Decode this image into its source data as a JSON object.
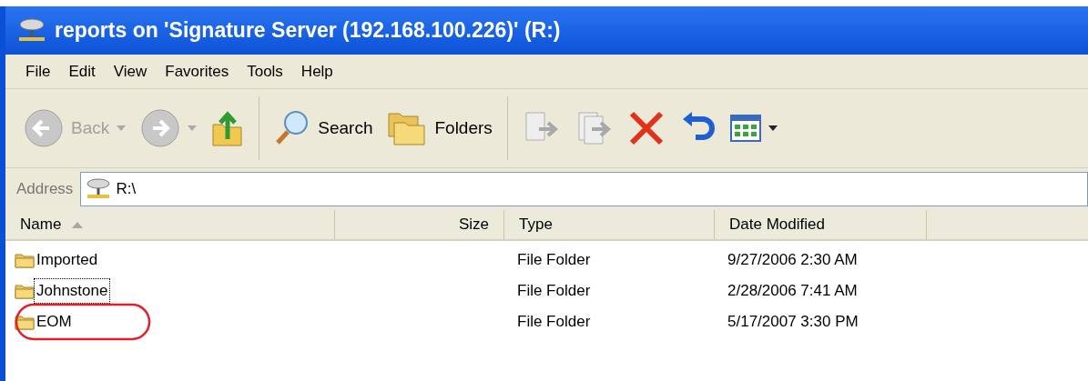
{
  "window": {
    "title": "reports on 'Signature Server (192.168.100.226)' (R:)"
  },
  "menu": [
    "File",
    "Edit",
    "View",
    "Favorites",
    "Tools",
    "Help"
  ],
  "toolbar": [
    {
      "kind": "back",
      "label": "Back",
      "disabled": true
    },
    {
      "kind": "forward",
      "disabled": true
    },
    {
      "kind": "up",
      "disabled": false
    },
    {
      "kind": "search",
      "label": "Search",
      "disabled": false
    },
    {
      "kind": "folders",
      "label": "Folders",
      "disabled": false
    },
    {
      "kind": "move",
      "disabled": true
    },
    {
      "kind": "copy",
      "disabled": true
    },
    {
      "kind": "delete",
      "disabled": false
    },
    {
      "kind": "undo",
      "disabled": false
    },
    {
      "kind": "views",
      "disabled": false
    }
  ],
  "address": {
    "label": "Address",
    "value": "R:\\"
  },
  "table": {
    "columns": [
      {
        "label": "Name",
        "sorted": true
      },
      {
        "label": "Size",
        "sorted": false
      },
      {
        "label": "Type",
        "sorted": false
      },
      {
        "label": "Date Modified",
        "sorted": false
      }
    ],
    "rows": [
      {
        "name": "Imported",
        "type": "File Folder",
        "date": "9/27/2006 2:30 AM",
        "focused": false,
        "circled": false
      },
      {
        "name": "Johnstone",
        "type": "File Folder",
        "date": "2/28/2006 7:41 AM",
        "focused": true,
        "circled": false
      },
      {
        "name": "EOM",
        "type": "File Folder",
        "date": "5/17/2007 3:30 PM",
        "focused": false,
        "circled": true
      }
    ]
  }
}
